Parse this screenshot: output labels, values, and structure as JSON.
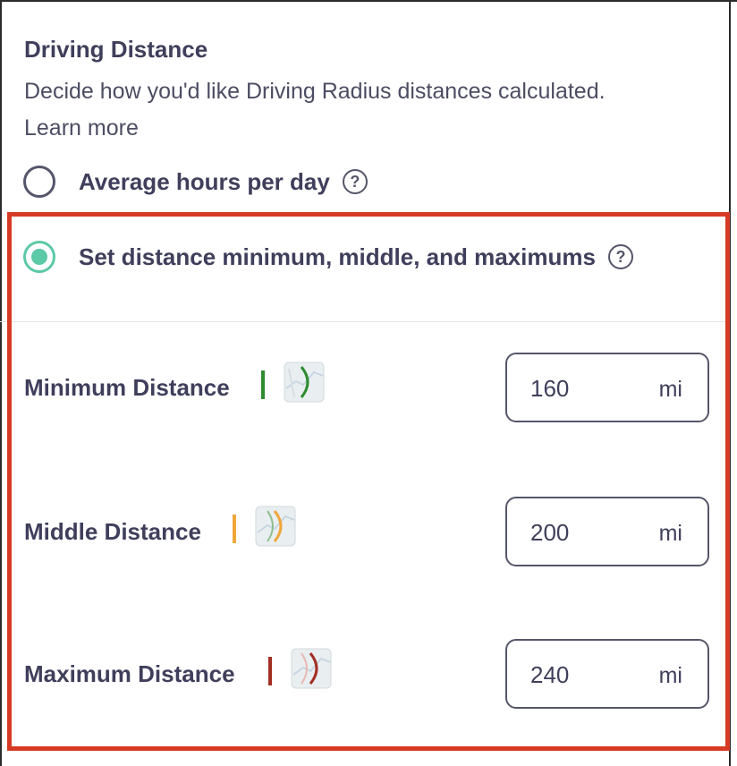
{
  "section": {
    "title": "Driving Distance",
    "description": "Decide how you'd like Driving Radius distances calculated.",
    "learn_more": "Learn more"
  },
  "options": [
    {
      "label": "Average hours per day",
      "selected": false,
      "help_icon": "question-circle-icon"
    },
    {
      "label": "Set distance minimum, middle, and maximums",
      "selected": true,
      "help_icon": "question-circle-icon"
    }
  ],
  "distances": [
    {
      "label": "Minimum Distance",
      "value": "160",
      "unit": "mi",
      "color": "#2e8b2e",
      "icon": "map-radius-icon"
    },
    {
      "label": "Middle Distance",
      "value": "200",
      "unit": "mi",
      "color": "#f0a63a",
      "icon": "map-radius-icon"
    },
    {
      "label": "Maximum Distance",
      "value": "240",
      "unit": "mi",
      "color": "#a12f23",
      "icon": "map-radius-icon"
    }
  ],
  "colors": {
    "radio_selected": "#5cc9a7",
    "highlight_border": "#d63a25",
    "text": "#3f3f5c"
  }
}
